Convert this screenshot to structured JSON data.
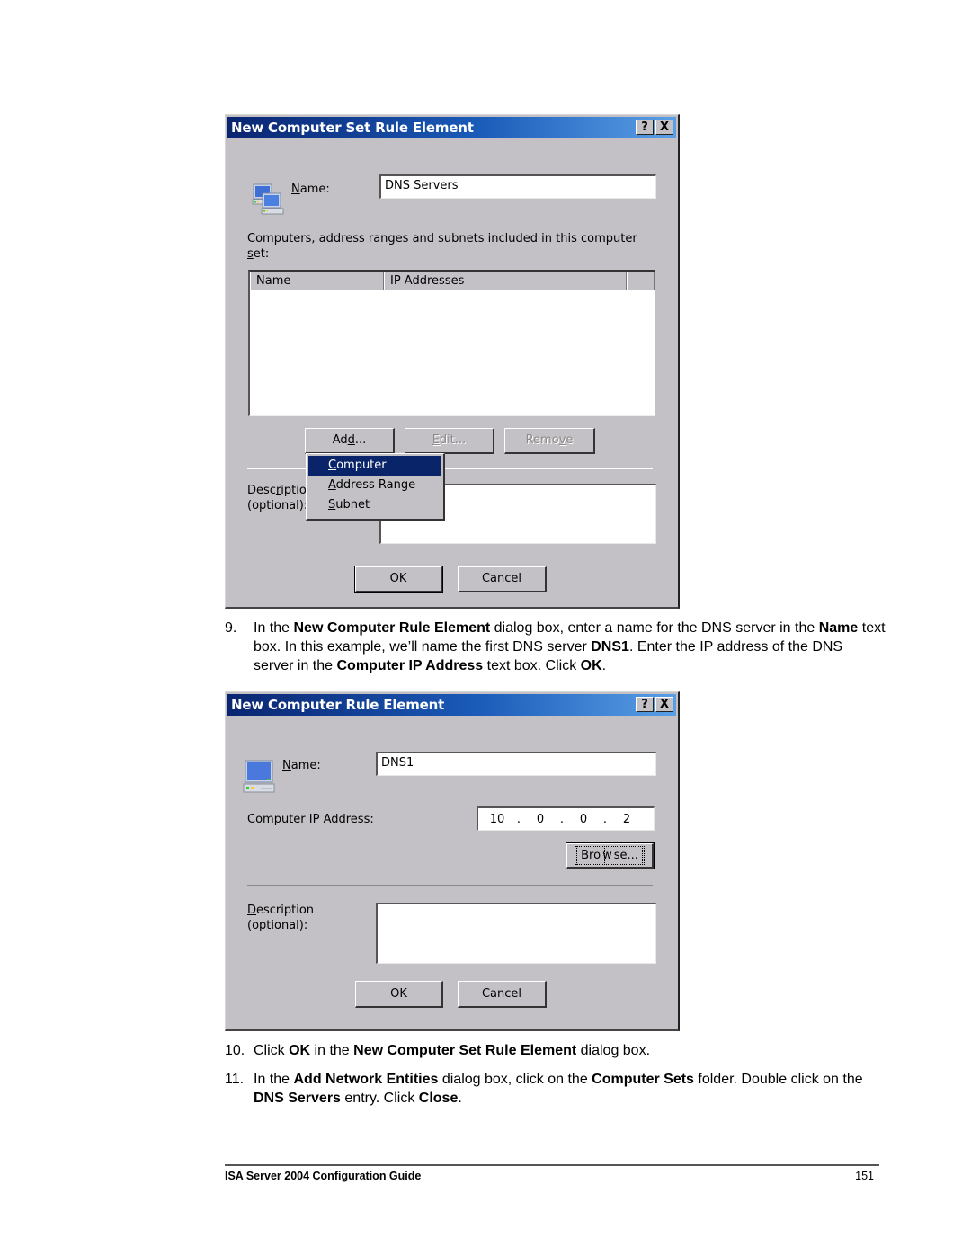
{
  "dialog1": {
    "title": "New Computer Set Rule Element",
    "help_button": "?",
    "close_button": "X",
    "icon": "computer-set-icon",
    "name_label_u": "N",
    "name_label_rest": "ame:",
    "name_value": "DNS Servers",
    "list_caption_line1": "Computers, address ranges and subnets included in this computer",
    "list_caption_u": "s",
    "list_caption_rest": "et:",
    "columns": [
      "Name",
      "IP Addresses",
      ""
    ],
    "rows": [],
    "buttons": {
      "add_pre": "Ad",
      "add_u": "d",
      "add_post": "...",
      "edit_u": "E",
      "edit_post": "dit...",
      "remove_pre": "Remo",
      "remove_u": "v",
      "remove_post": "e",
      "ok": "OK",
      "cancel": "Cancel"
    },
    "add_menu": [
      {
        "u": "C",
        "rest": "omputer",
        "selected": true
      },
      {
        "u": "A",
        "rest": "ddress Range",
        "selected": false
      },
      {
        "u": "S",
        "rest": "ubnet",
        "selected": false
      }
    ],
    "desc_label_pre": "Desc",
    "desc_label_u": "r",
    "desc_label_post": "iption",
    "desc_label_line2": "(optional):",
    "desc_value": ""
  },
  "step9": {
    "number": "9.",
    "parts": [
      {
        "t": "In the ",
        "b": false
      },
      {
        "t": "New Computer Rule Element",
        "b": true
      },
      {
        "t": " dialog box, enter a name for the DNS server in the ",
        "b": false
      },
      {
        "t": "Name",
        "b": true
      },
      {
        "t": " text box. In this example, we’ll name the first DNS server ",
        "b": false
      },
      {
        "t": "DNS1",
        "b": true
      },
      {
        "t": ". Enter the IP address of the DNS server in the ",
        "b": false
      },
      {
        "t": "Computer IP Address",
        "b": true
      },
      {
        "t": " text box. Click ",
        "b": false
      },
      {
        "t": "OK",
        "b": true
      },
      {
        "t": ".",
        "b": false
      }
    ]
  },
  "dialog2": {
    "title": "New Computer Rule Element",
    "help_button": "?",
    "close_button": "X",
    "icon": "computer-icon",
    "name_label_u": "N",
    "name_label_rest": "ame:",
    "name_value": "DNS1",
    "ip_label_pre": "Computer ",
    "ip_label_u": "I",
    "ip_label_post": "P Address:",
    "ip_octets": [
      "10",
      "0",
      "0",
      "2"
    ],
    "ip_dot": ".",
    "browse_pre": "Bro",
    "browse_u": "w",
    "browse_post": "se...",
    "desc_label_u": "D",
    "desc_label_rest": "escription",
    "desc_label_line2": "(optional):",
    "desc_value": "",
    "ok": "OK",
    "cancel": "Cancel"
  },
  "step10": {
    "number": "10.",
    "parts": [
      {
        "t": "Click ",
        "b": false
      },
      {
        "t": "OK",
        "b": true
      },
      {
        "t": " in the ",
        "b": false
      },
      {
        "t": "New Computer Set Rule Element",
        "b": true
      },
      {
        "t": " dialog box.",
        "b": false
      }
    ]
  },
  "step11": {
    "number": "11.",
    "parts": [
      {
        "t": "In the ",
        "b": false
      },
      {
        "t": "Add Network Entities",
        "b": true
      },
      {
        "t": " dialog box, click on the ",
        "b": false
      },
      {
        "t": "Computer Sets",
        "b": true
      },
      {
        "t": " folder. Double click on the ",
        "b": false
      },
      {
        "t": "DNS Servers",
        "b": true
      },
      {
        "t": " entry. Click ",
        "b": false
      },
      {
        "t": "Close",
        "b": true
      },
      {
        "t": ".",
        "b": false
      }
    ]
  },
  "footer": {
    "title": "ISA Server 2004 Configuration Guide",
    "page": "151"
  }
}
